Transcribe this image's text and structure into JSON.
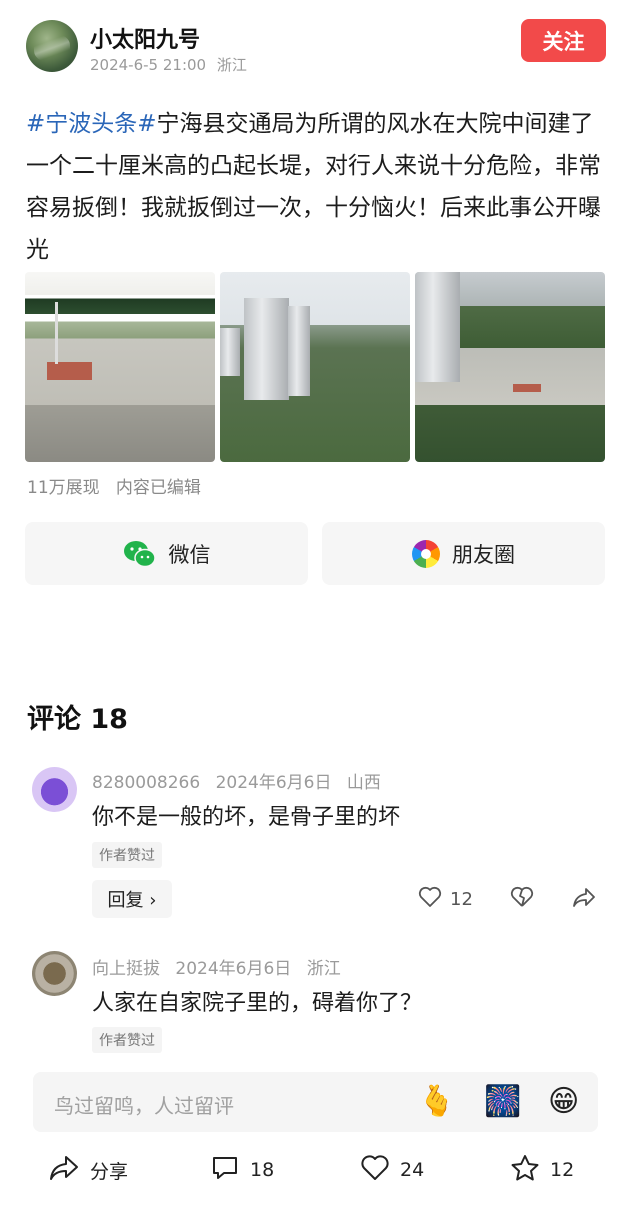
{
  "post": {
    "username": "小太阳九号",
    "datetime": "2024-6-5 21:00",
    "location": "浙江",
    "follow_label": "关注",
    "tag": "#宁波头条#",
    "text": "宁海县交通局为所谓的风水在大院中间建了一个二十厘米高的凸起长堤，对行人来说十分危险，非常容易扳倒！我就扳倒过一次，十分恼火！后来此事公开曝光",
    "stats": "11万展现   内容已编辑"
  },
  "share": {
    "wechat_label": "微信",
    "moments_label": "朋友圈"
  },
  "comments_section": {
    "title": "评论 18",
    "items": [
      {
        "user": "8280008266",
        "date": "2024年6月6日",
        "region": "山西",
        "text": "你不是一般的坏，是骨子里的坏",
        "badge": "作者赞过",
        "reply_label": "回复 ›",
        "likes": "12"
      },
      {
        "user": "向上挺拔",
        "date": "2024年6月6日",
        "region": "浙江",
        "text": "人家在自家院子里的，碍着你了？",
        "badge": "作者赞过"
      }
    ]
  },
  "input": {
    "placeholder": "鸟过留鸣，人过留评",
    "emojis": [
      "🫰",
      "🎆",
      "😁"
    ]
  },
  "bottom_bar": {
    "share_label": "分享",
    "comment_count": "18",
    "like_count": "24",
    "fav_count": "12"
  },
  "colors": {
    "accent": "#f24a4a",
    "tag": "#2a66b8"
  }
}
